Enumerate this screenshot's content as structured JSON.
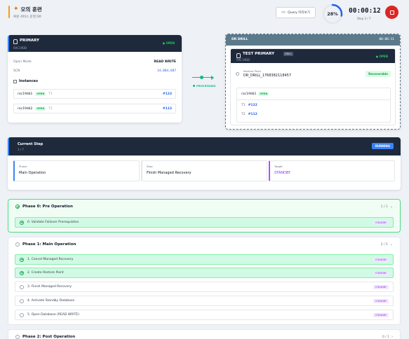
{
  "header": {
    "title": "모의 훈련",
    "subtitle": "복원 서비스 운영 DR",
    "query_label": "Query 미리보기",
    "progress_percent": 28,
    "progress_label": "28%",
    "timer": "00:00:12",
    "step_of": "Step 3 / 7"
  },
  "primary": {
    "name": "PRIMARY",
    "sub": "RAC19DB",
    "status": "● OPEN",
    "open_mode_label": "Open Mode",
    "open_mode_value": "READ WRITE",
    "scn_label": "SCN",
    "scn_value": "14,804,687",
    "instances_label": "Instances",
    "instances": [
      {
        "name": "rac19db1",
        "status": "OPEN",
        "thread": "T1",
        "seq": "#123"
      },
      {
        "name": "rac19db2",
        "status": "OPEN",
        "thread": "T2",
        "seq": "#113"
      }
    ]
  },
  "connector": {
    "label": "PROCESSING"
  },
  "dr": {
    "label": "DR DRILL",
    "timer": "00:00:11",
    "name": "TEST PRIMARY",
    "tag": "DRILL",
    "sub": "RAC19DB",
    "status": "● OPEN",
    "restore_label": "Restore Point",
    "restore_value": "DR_DRILL_1768382118457",
    "restore_badge": "Recoverable",
    "inst_name": "rac19db1",
    "inst_status": "OPEN",
    "t1_label": "T1",
    "t1_value": "#122",
    "t2_label": "T2",
    "t2_value": "#112"
  },
  "current_step": {
    "title": "Current Step",
    "count": "3 / 7",
    "status": "RUNNING",
    "phase_label": "Phase",
    "phase_value": "Main Operation",
    "step_label": "Step",
    "step_value": "Finish Managed Recovery",
    "target_label": "Target",
    "target_value": "STANDBY"
  },
  "phases": [
    {
      "title": "Phase 0: Pre Operation",
      "count": "1 / 1",
      "tasks": [
        {
          "label": "0. Validate Failover Prerequisites",
          "tag": "STANDBY",
          "done": true
        }
      ]
    },
    {
      "title": "Phase 1: Main Operation",
      "count": "2 / 5",
      "tasks": [
        {
          "label": "1. Cancel Managed Recovery",
          "tag": "STANDBY",
          "done": true
        },
        {
          "label": "2. Create Restore Point",
          "tag": "STANDBY",
          "done": true
        },
        {
          "label": "3. Finish Managed Recovery",
          "tag": "STANDBY",
          "done": false
        },
        {
          "label": "4. Activate Standby Database",
          "tag": "STANDBY",
          "done": false
        },
        {
          "label": "5. Open Database (READ WRITE)",
          "tag": "STANDBY",
          "done": false
        }
      ]
    },
    {
      "title": "Phase 2: Post Operation",
      "count": "0 / 1",
      "tasks": []
    }
  ],
  "colors": {
    "accent": "#3b82f6",
    "success": "#16a34a",
    "danger": "#dc2626",
    "target": "#9333ea"
  }
}
